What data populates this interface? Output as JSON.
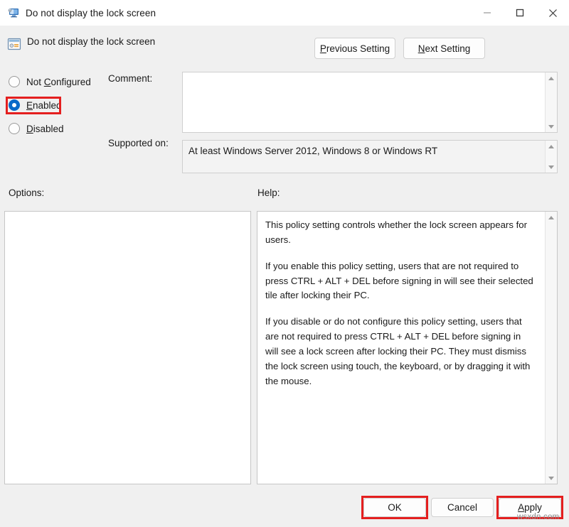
{
  "window": {
    "title": "Do not display the lock screen",
    "icon": "policy-monitor-icon",
    "minimize_label": "—",
    "maximize_label": "☐",
    "close_label": "✕"
  },
  "header": {
    "icon": "policy-setting-icon",
    "title": "Do not display the lock screen",
    "previous_button": {
      "accel": "P",
      "rest": "revious Setting"
    },
    "next_button": {
      "accel": "N",
      "rest": "ext Setting"
    }
  },
  "state_options": {
    "selected": "Enabled",
    "items": [
      {
        "label_pre": "Not ",
        "accel": "C",
        "label_post": "onfigured",
        "checked": false,
        "name": "not-configured"
      },
      {
        "label_pre": "",
        "accel": "E",
        "label_post": "nabled",
        "checked": true,
        "name": "enabled"
      },
      {
        "label_pre": "",
        "accel": "D",
        "label_post": "isabled",
        "checked": false,
        "name": "disabled"
      }
    ]
  },
  "fields": {
    "comment_label": "Comment:",
    "comment_value": "",
    "supported_label": "Supported on:",
    "supported_value": "At least Windows Server 2012, Windows 8 or Windows RT"
  },
  "panes": {
    "options_label": "Options:",
    "options_content": "",
    "help_label": "Help:",
    "help_paragraphs": [
      "This policy setting controls whether the lock screen appears for users.",
      "If you enable this policy setting, users that are not required to press CTRL + ALT + DEL before signing in will see their selected tile after locking their PC.",
      "If you disable or do not configure this policy setting, users that are not required to press CTRL + ALT + DEL before signing in will see a lock screen after locking their PC. They must dismiss the lock screen using touch, the keyboard, or by dragging it with the mouse."
    ]
  },
  "footer": {
    "ok_label": "OK",
    "cancel_label": "Cancel",
    "apply_accel": "A",
    "apply_rest": "pply"
  },
  "annotations": {
    "color": "#e41f1f",
    "highlighted": [
      "Enabled",
      "OK",
      "Apply"
    ]
  },
  "watermark": "wsxdn.com"
}
